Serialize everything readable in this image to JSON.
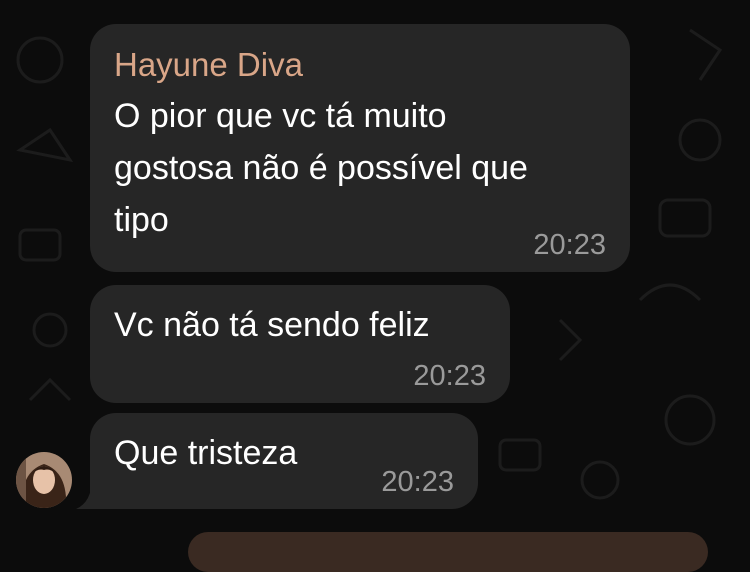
{
  "chat": {
    "sender_name": "Hayune Diva",
    "messages": [
      {
        "lines": [
          "O pior que vc tá muito",
          "gostosa não é possível que",
          "tipo"
        ],
        "time": "20:23"
      },
      {
        "lines": [
          "Vc não tá sendo feliz"
        ],
        "time": "20:23"
      },
      {
        "lines": [
          "Que tristeza"
        ],
        "time": "20:23"
      }
    ]
  },
  "colors": {
    "background": "#0c0c0c",
    "bubble_incoming": "#262626",
    "sender_name": "#d9a688",
    "timestamp": "#9a9a9a"
  },
  "icons": [
    "avatar"
  ]
}
